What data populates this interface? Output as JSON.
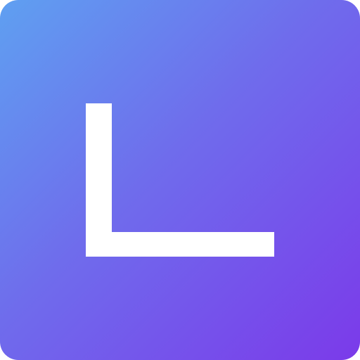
{
  "icon": {
    "letter": "L",
    "glyph_icon": "letter-l-icon",
    "colors": {
      "gradient_start": "#5fa0f1",
      "gradient_mid": "#6f6cec",
      "gradient_end": "#7b3aea",
      "glyph": "#ffffff"
    }
  }
}
